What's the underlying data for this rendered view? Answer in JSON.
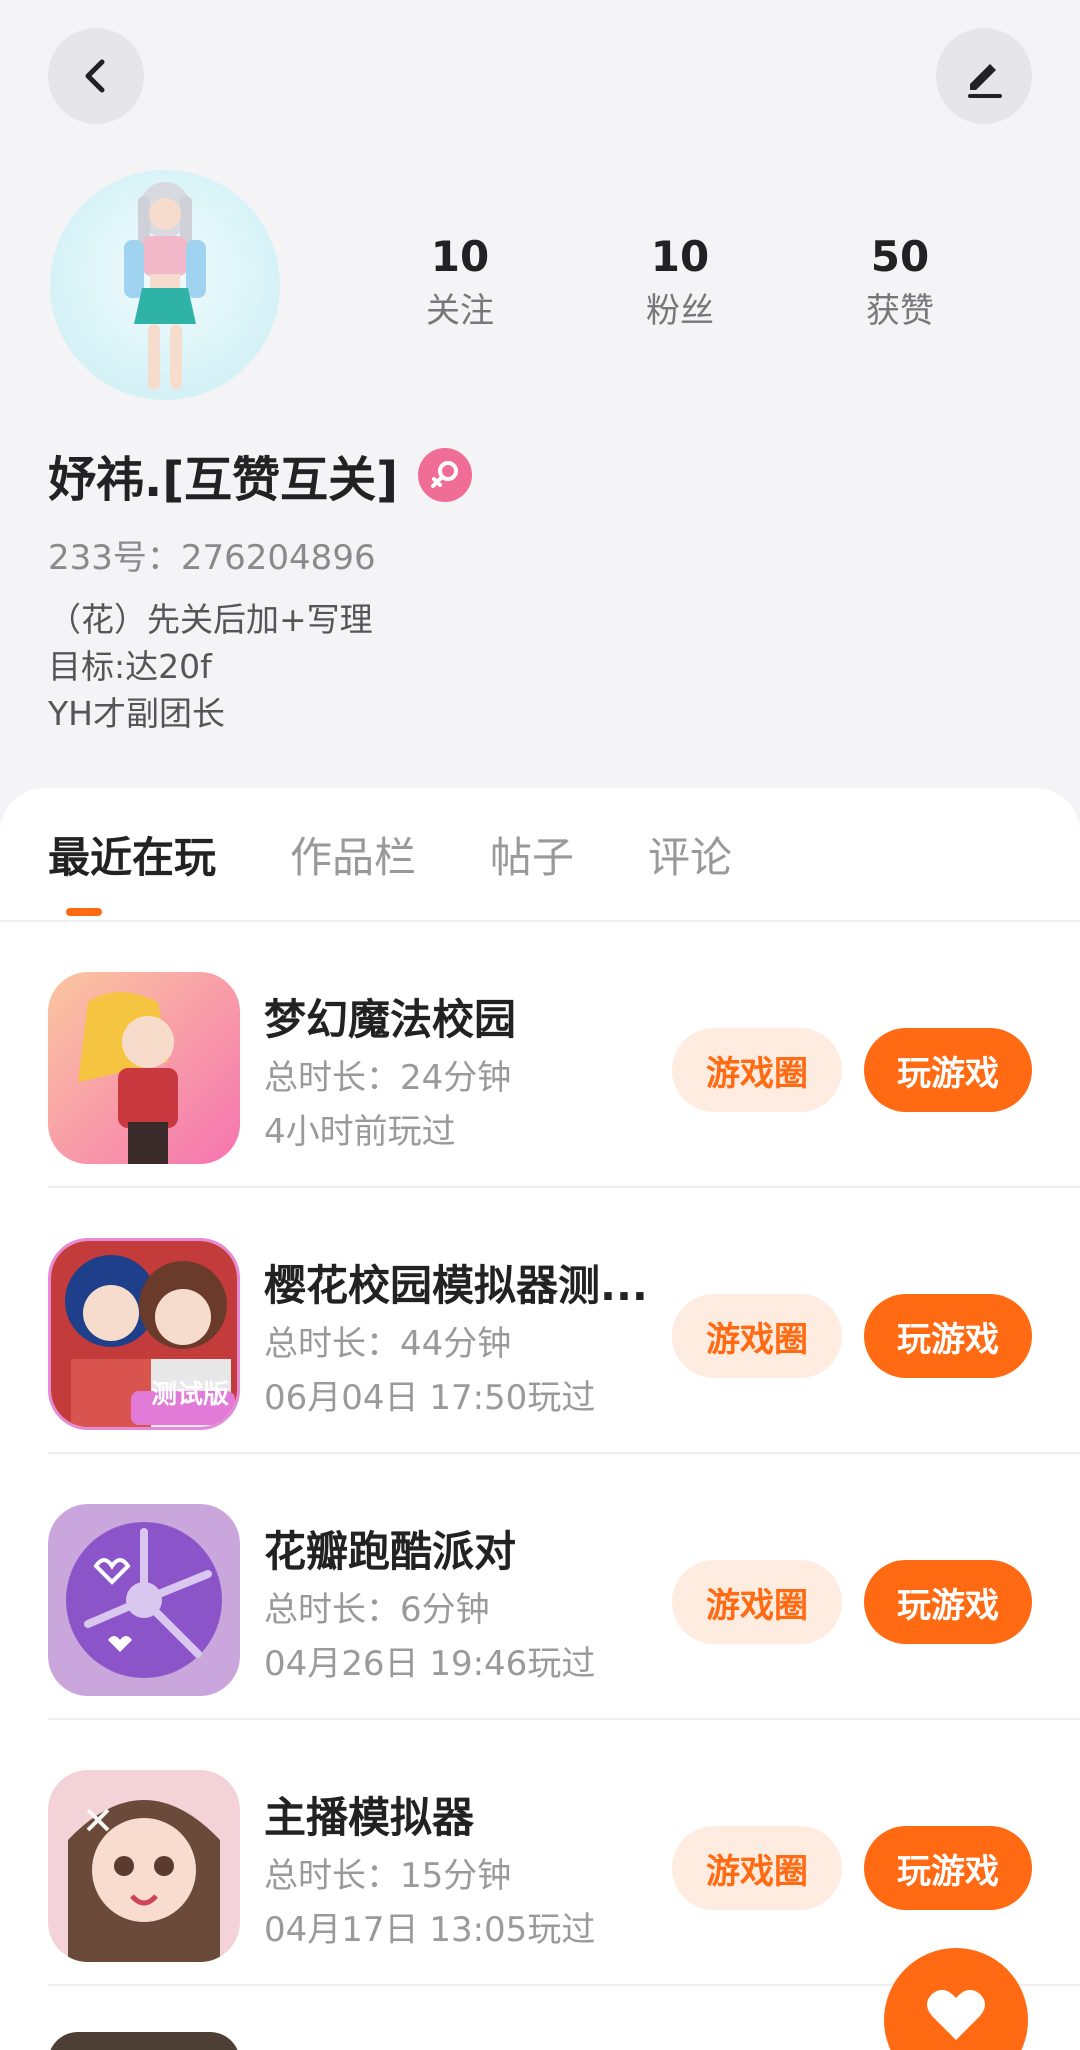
{
  "header": {
    "back_icon": "chevron-left-icon",
    "edit_icon": "pencil-icon"
  },
  "profile": {
    "stats": [
      {
        "value": "10",
        "label": "关注"
      },
      {
        "value": "10",
        "label": "粉丝"
      },
      {
        "value": "50",
        "label": "获赞"
      }
    ],
    "name": "妤祎.[互赞互关]",
    "gender_icon": "female-icon",
    "gender_color": "#f06d96",
    "uid": "233号：276204896",
    "bio": [
      "（花）先关后加+写理",
      "目标:达20f",
      "YH才副团长"
    ]
  },
  "tabs": [
    {
      "label": "最近在玩"
    },
    {
      "label": "作品栏"
    },
    {
      "label": "帖子"
    },
    {
      "label": "评论"
    }
  ],
  "games": [
    {
      "name": "梦幻魔法校园",
      "duration": "总时长：24分钟",
      "last_played": "4小时前玩过",
      "circle_label": "游戏圈",
      "play_label": "玩游戏"
    },
    {
      "name": "樱花校园模拟器测...",
      "duration": "总时长：44分钟",
      "last_played": "06月04日 17:50玩过",
      "circle_label": "游戏圈",
      "play_label": "玩游戏",
      "icon_badge": "测试版"
    },
    {
      "name": "花瓣跑酷派对",
      "duration": "总时长：6分钟",
      "last_played": "04月26日 19:46玩过",
      "circle_label": "游戏圈",
      "play_label": "玩游戏"
    },
    {
      "name": "主播模拟器",
      "duration": "总时长：15分钟",
      "last_played": "04月17日 13:05玩过",
      "circle_label": "游戏圈",
      "play_label": "玩游戏"
    }
  ],
  "colors": {
    "accent": "#ff6a12",
    "accent_light": "#ffece0"
  },
  "fab_icon": "heart-icon"
}
